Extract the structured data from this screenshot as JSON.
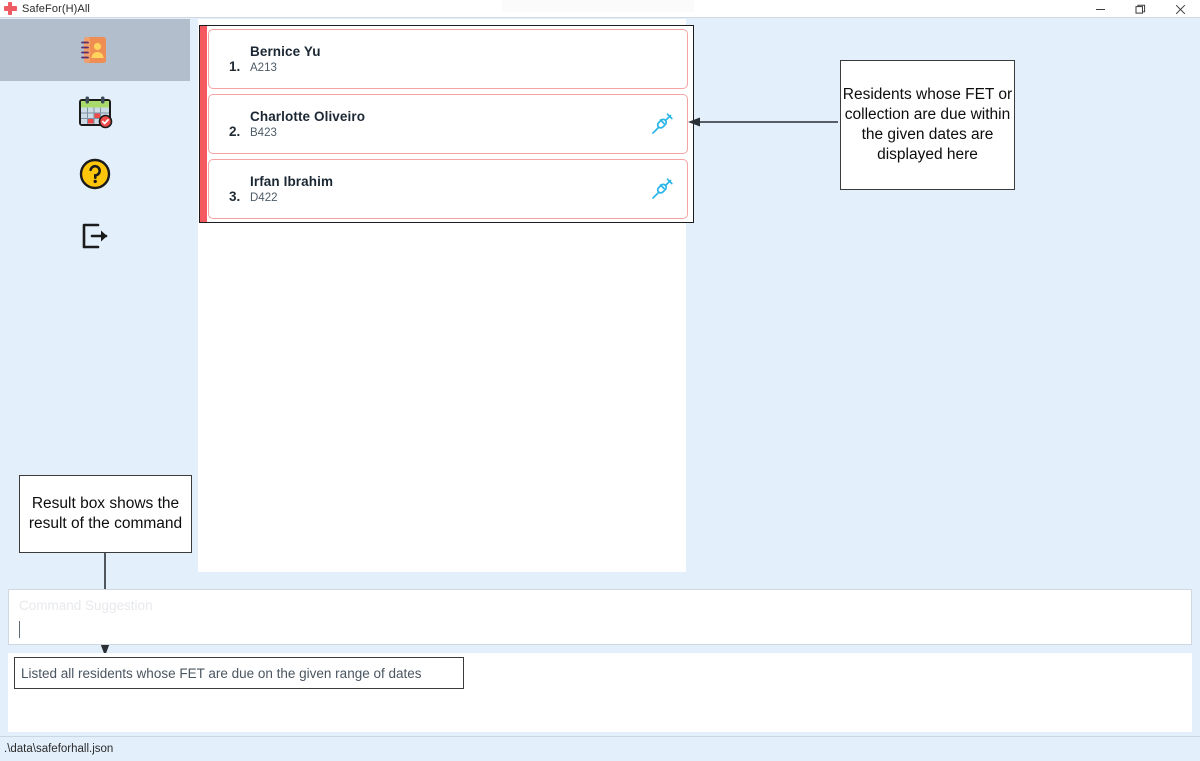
{
  "window": {
    "app_icon": "red-cross-icon",
    "title": "SafeFor(H)All",
    "controls": {
      "minimize": "minimize-icon",
      "maximize": "maximize-icon",
      "close": "close-icon"
    }
  },
  "sidebar": {
    "items": [
      {
        "icon": "address-book-icon",
        "selected": true
      },
      {
        "icon": "calendar-check-icon",
        "selected": false
      },
      {
        "icon": "help-circle-icon",
        "selected": false
      },
      {
        "icon": "exit-icon",
        "selected": false
      }
    ]
  },
  "resident_list": [
    {
      "index": "1.",
      "name": "Bernice Yu",
      "room": "A213",
      "icon": "syringe-icon",
      "icon_visible": false
    },
    {
      "index": "2.",
      "name": "Charlotte Oliveiro",
      "room": "B423",
      "icon": "syringe-icon",
      "icon_visible": true
    },
    {
      "index": "3.",
      "name": "Irfan Ibrahim",
      "room": "D422",
      "icon": "syringe-icon",
      "icon_visible": true
    }
  ],
  "annotations": {
    "top": "Residents whose FET or collection are due within the given dates are displayed here",
    "bottom": "Result box shows the result of the command"
  },
  "command": {
    "suggestion_placeholder": "Command Suggestion",
    "value": ""
  },
  "result": {
    "text": "Listed all residents whose FET are due on the given range of dates"
  },
  "status": {
    "file_path": ".\\data\\safeforhall.json"
  },
  "colors": {
    "background": "#e3effb",
    "accent_red": "#f4595f",
    "row_border": "#f7a2a3",
    "syringe_blue": "#29b6e8",
    "sidebar_selected": "#b2becb"
  }
}
